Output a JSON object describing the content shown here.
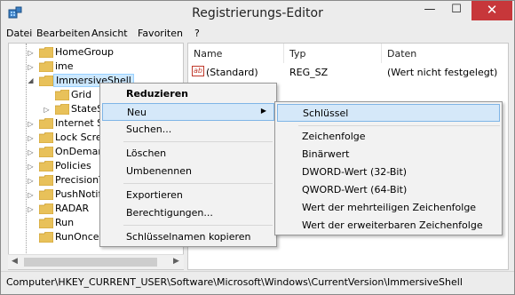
{
  "window": {
    "title": "Registrierungs-Editor",
    "min_glyph": "—",
    "max_glyph": "☐",
    "close_glyph": "✕"
  },
  "menubar": {
    "items": [
      "Datei",
      "Bearbeiten",
      "Ansicht",
      "Favoriten",
      "?"
    ]
  },
  "tree": {
    "items": [
      {
        "label": "HomeGroup",
        "expander": "▷"
      },
      {
        "label": "ime",
        "expander": "▷"
      },
      {
        "label": "ImmersiveShell",
        "expander": "◢"
      },
      {
        "label": "Grid",
        "expander": ""
      },
      {
        "label": "StateSt",
        "expander": "▷"
      },
      {
        "label": "Internet Se",
        "expander": "▷"
      },
      {
        "label": "Lock Scree",
        "expander": "▷"
      },
      {
        "label": "OnDeman",
        "expander": "▷"
      },
      {
        "label": "Policies",
        "expander": "▷"
      },
      {
        "label": "PrecisionT",
        "expander": "▷"
      },
      {
        "label": "PushNotif",
        "expander": "▷"
      },
      {
        "label": "RADAR",
        "expander": "▷"
      },
      {
        "label": "Run",
        "expander": ""
      },
      {
        "label": "RunOnce",
        "expander": ""
      }
    ]
  },
  "list": {
    "columns": [
      "Name",
      "Typ",
      "Daten"
    ],
    "rows": [
      {
        "name": "(Standard)",
        "type": "REG_SZ",
        "data": "(Wert nicht festgelegt)",
        "icon": "ab"
      }
    ]
  },
  "context_menu": {
    "items": [
      {
        "label": "Reduzieren"
      },
      {
        "label": "Neu",
        "arrow": "▶"
      },
      {
        "label": "Suchen..."
      },
      {
        "label": "Löschen"
      },
      {
        "label": "Umbenennen"
      },
      {
        "label": "Exportieren"
      },
      {
        "label": "Berechtigungen..."
      },
      {
        "label": "Schlüsselnamen kopieren"
      }
    ]
  },
  "submenu": {
    "items": [
      {
        "label": "Schlüssel"
      },
      {
        "label": "Zeichenfolge"
      },
      {
        "label": "Binärwert"
      },
      {
        "label": "DWORD-Wert (32-Bit)"
      },
      {
        "label": "QWORD-Wert (64-Bit)"
      },
      {
        "label": "Wert der mehrteiligen Zeichenfolge"
      },
      {
        "label": "Wert der erweiterbaren Zeichenfolge"
      }
    ]
  },
  "statusbar": {
    "path": "Computer\\HKEY_CURRENT_USER\\Software\\Microsoft\\Windows\\CurrentVersion\\ImmersiveShell"
  },
  "colors": {
    "folder": "#e8c15a",
    "close": "#c7373a",
    "selection": "#cce8ff"
  }
}
